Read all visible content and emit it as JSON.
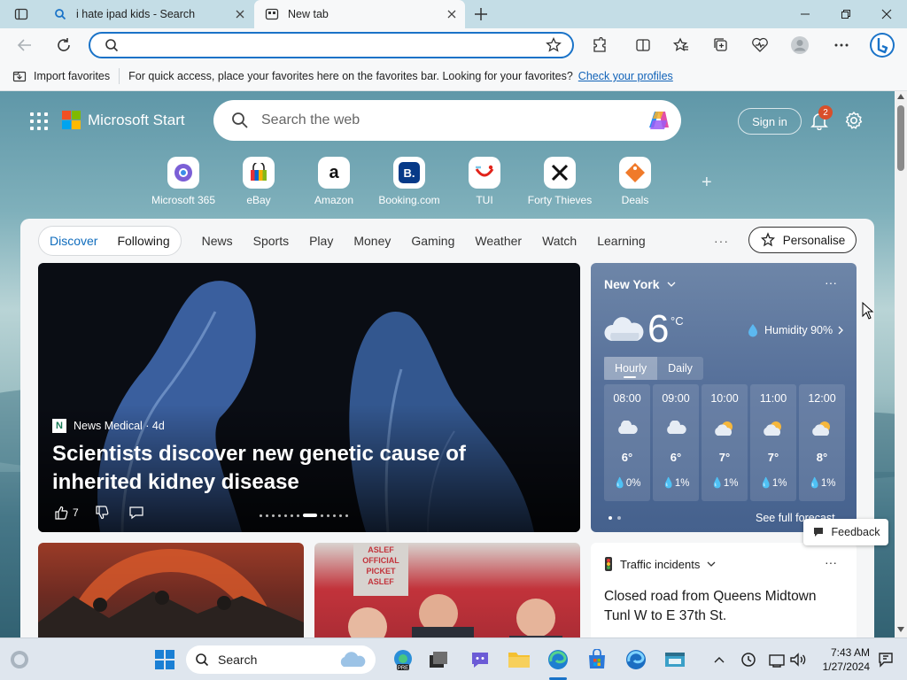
{
  "browser": {
    "tabs": [
      {
        "title": "i hate ipad kids - Search"
      },
      {
        "title": "New tab"
      }
    ],
    "address_placeholder": "",
    "favorites_bar": {
      "import_label": "Import favorites",
      "message": "For quick access, place your favorites here on the favorites bar. Looking for your favorites?",
      "link": "Check your profiles"
    }
  },
  "page": {
    "brand": "Microsoft Start",
    "search_placeholder": "Search the web",
    "sign_in": "Sign in",
    "notifications_count": "2",
    "quick_links": [
      {
        "label": "Microsoft 365"
      },
      {
        "label": "eBay"
      },
      {
        "label": "Amazon"
      },
      {
        "label": "Booking.com"
      },
      {
        "label": "TUI"
      },
      {
        "label": "Forty Thieves"
      },
      {
        "label": "Deals"
      }
    ],
    "nav": {
      "discover": "Discover",
      "following": "Following",
      "items": [
        "News",
        "Sports",
        "Play",
        "Money",
        "Gaming",
        "Weather",
        "Watch",
        "Learning"
      ],
      "more": "···",
      "personalise": "Personalise"
    },
    "hero": {
      "source": "News Medical · 4d",
      "headline": "Scientists discover new genetic cause of inherited kidney disease",
      "likes": "7"
    },
    "weather": {
      "city": "New York",
      "temp": "6",
      "unit": "°C",
      "humidity": "Humidity 90%",
      "tab_hourly": "Hourly",
      "tab_daily": "Daily",
      "hours": [
        {
          "time": "08:00",
          "temp": "6°",
          "precip": "0%",
          "icon": "cloud"
        },
        {
          "time": "09:00",
          "temp": "6°",
          "precip": "1%",
          "icon": "cloud"
        },
        {
          "time": "10:00",
          "temp": "7°",
          "precip": "1%",
          "icon": "partly-sunny"
        },
        {
          "time": "11:00",
          "temp": "7°",
          "precip": "1%",
          "icon": "partly-sunny"
        },
        {
          "time": "12:00",
          "temp": "8°",
          "precip": "1%",
          "icon": "partly-sunny"
        }
      ],
      "full_forecast": "See full forecast"
    },
    "card2_sign": "ASLEF OFFICIAL PICKET ASLEF",
    "traffic": {
      "title": "Traffic incidents",
      "text": "Closed road from Queens Midtown Tunl W to E 37th St."
    },
    "feedback": "Feedback"
  },
  "taskbar": {
    "search": "Search",
    "time": "7:43 AM",
    "date": "1/27/2024"
  },
  "colors": {
    "accent": "#0f6cbd",
    "titlebar": "#c4dde6",
    "address_border": "#1a73c8"
  }
}
